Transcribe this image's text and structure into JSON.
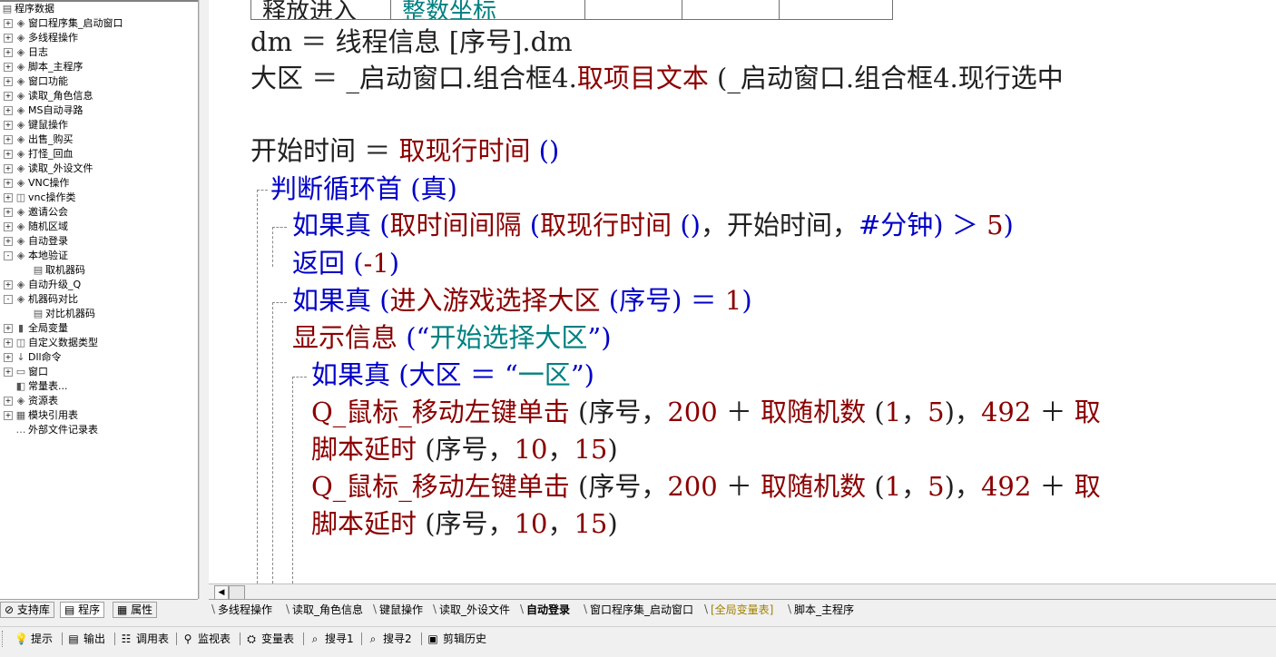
{
  "tree": {
    "root": "程序数据",
    "items": [
      {
        "label": "窗口程序集_启动窗口",
        "exp": "+",
        "icon": "module-icon"
      },
      {
        "label": "多线程操作",
        "exp": "+",
        "icon": "module-icon"
      },
      {
        "label": "日志",
        "exp": "+",
        "icon": "module-icon"
      },
      {
        "label": "脚本_主程序",
        "exp": "+",
        "icon": "module-icon"
      },
      {
        "label": "窗口功能",
        "exp": "+",
        "icon": "module-icon"
      },
      {
        "label": "读取_角色信息",
        "exp": "+",
        "icon": "module-icon"
      },
      {
        "label": "MS自动寻路",
        "exp": "+",
        "icon": "module-icon"
      },
      {
        "label": "键鼠操作",
        "exp": "+",
        "icon": "module-icon"
      },
      {
        "label": "出售_购买",
        "exp": "+",
        "icon": "module-icon"
      },
      {
        "label": "打怪_回血",
        "exp": "+",
        "icon": "module-icon"
      },
      {
        "label": "读取_外设文件",
        "exp": "+",
        "icon": "module-icon"
      },
      {
        "label": "VNC操作",
        "exp": "+",
        "icon": "module-icon"
      },
      {
        "label": "vnc操作类",
        "exp": "+",
        "icon": "class-icon"
      },
      {
        "label": "邀请公会",
        "exp": "+",
        "icon": "module-icon"
      },
      {
        "label": "随机区域",
        "exp": "+",
        "icon": "module-icon"
      },
      {
        "label": "自动登录",
        "exp": "+",
        "icon": "module-icon"
      },
      {
        "label": "本地验证",
        "exp": "-",
        "icon": "module-icon"
      },
      {
        "label": "取机器码",
        "exp": "",
        "icon": "sub-icon",
        "indent": 1
      },
      {
        "label": "自动升级_Q",
        "exp": "+",
        "icon": "module-icon"
      },
      {
        "label": "机器码对比",
        "exp": "-",
        "icon": "module-icon"
      },
      {
        "label": "对比机器码",
        "exp": "",
        "icon": "sub-icon",
        "indent": 1
      },
      {
        "label": "全局变量",
        "exp": "+",
        "icon": "globals-icon"
      },
      {
        "label": "自定义数据类型",
        "exp": "+",
        "icon": "datatype-icon"
      },
      {
        "label": "Dll命令",
        "exp": "+",
        "icon": "dll-icon"
      },
      {
        "label": "窗口",
        "exp": "+",
        "icon": "window-icon"
      },
      {
        "label": "常量表...",
        "exp": "",
        "icon": "const-icon"
      },
      {
        "label": "资源表",
        "exp": "+",
        "icon": "resource-icon"
      },
      {
        "label": "模块引用表",
        "exp": "+",
        "icon": "modref-icon"
      },
      {
        "label": "外部文件记录表",
        "exp": "",
        "icon": "file-icon"
      }
    ]
  },
  "code": {
    "table_cells": [
      "释放进入",
      "整数坐标",
      "",
      "",
      ""
    ],
    "lines": [
      [
        [
          "kw-dark",
          "dm ＝ 线程信息 [序号].dm"
        ]
      ],
      [
        [
          "kw-dark",
          "大区 ＝ _启动窗口.组合框4."
        ],
        [
          "kw-red",
          "取项目文本"
        ],
        [
          "kw-dark",
          " (_启动窗口.组合框4.现行选中"
        ]
      ],
      [],
      [
        [
          "kw-dark",
          "开始时间 ＝ "
        ],
        [
          "kw-red",
          "取现行时间"
        ],
        [
          "kw-blue",
          " ()"
        ]
      ],
      [
        [
          "kw-blue",
          "判断循环首 (真)"
        ]
      ],
      [
        [
          "kw-blue",
          "如果真 ("
        ],
        [
          "kw-red",
          "取时间间隔"
        ],
        [
          "kw-blue",
          " ("
        ],
        [
          "kw-red",
          "取现行时间"
        ],
        [
          "kw-blue",
          " ()"
        ],
        [
          "kw-dark",
          "，开始时间，"
        ],
        [
          "kw-blue",
          "#分钟) ＞ "
        ],
        [
          "kw-red",
          "5"
        ],
        [
          "kw-blue",
          ")"
        ]
      ],
      [
        [
          "kw-blue",
          "返回 ("
        ],
        [
          "kw-red",
          "-1"
        ],
        [
          "kw-blue",
          ")"
        ]
      ],
      [
        [
          "kw-blue",
          "如果真 ("
        ],
        [
          "kw-red",
          "进入游戏选择大区"
        ],
        [
          "kw-blue",
          " (序号) ＝ "
        ],
        [
          "kw-red",
          "1"
        ],
        [
          "kw-blue",
          ")"
        ]
      ],
      [
        [
          "kw-red",
          "显示信息"
        ],
        [
          "kw-blue",
          " (“"
        ],
        [
          "kw-teal",
          "开始选择大区"
        ],
        [
          "kw-blue",
          "”)"
        ]
      ],
      [
        [
          "kw-blue",
          "如果真 (大区 ＝ “"
        ],
        [
          "kw-teal",
          "一区"
        ],
        [
          "kw-blue",
          "”)"
        ]
      ],
      [
        [
          "kw-red",
          "Q_鼠标_移动左键单击"
        ],
        [
          "kw-dark",
          " (序号，"
        ],
        [
          "kw-red",
          "200"
        ],
        [
          "kw-dark",
          " ＋ "
        ],
        [
          "kw-red",
          "取随机数"
        ],
        [
          "kw-dark",
          " ("
        ],
        [
          "kw-red",
          "1"
        ],
        [
          "kw-dark",
          "，"
        ],
        [
          "kw-red",
          "5"
        ],
        [
          "kw-dark",
          ")，"
        ],
        [
          "kw-red",
          "492"
        ],
        [
          "kw-dark",
          " ＋ "
        ],
        [
          "kw-red",
          "取"
        ]
      ],
      [
        [
          "kw-red",
          "脚本延时"
        ],
        [
          "kw-dark",
          " (序号，"
        ],
        [
          "kw-red",
          "10"
        ],
        [
          "kw-dark",
          "，"
        ],
        [
          "kw-red",
          "15"
        ],
        [
          "kw-dark",
          ")"
        ]
      ],
      [
        [
          "kw-red",
          "Q_鼠标_移动左键单击"
        ],
        [
          "kw-dark",
          " (序号，"
        ],
        [
          "kw-red",
          "200"
        ],
        [
          "kw-dark",
          " ＋ "
        ],
        [
          "kw-red",
          "取随机数"
        ],
        [
          "kw-dark",
          " ("
        ],
        [
          "kw-red",
          "1"
        ],
        [
          "kw-dark",
          "，"
        ],
        [
          "kw-red",
          "5"
        ],
        [
          "kw-dark",
          ")，"
        ],
        [
          "kw-red",
          "492"
        ],
        [
          "kw-dark",
          " ＋ "
        ],
        [
          "kw-red",
          "取"
        ]
      ],
      [
        [
          "kw-red",
          "脚本延时"
        ],
        [
          "kw-dark",
          " (序号，"
        ],
        [
          "kw-red",
          "10"
        ],
        [
          "kw-dark",
          "，"
        ],
        [
          "kw-red",
          "15"
        ],
        [
          "kw-dark",
          ")"
        ]
      ]
    ]
  },
  "left_tabs": [
    {
      "label": "支持库",
      "icon": "library-icon"
    },
    {
      "label": "程序",
      "icon": "program-icon",
      "active": true
    },
    {
      "label": "属性",
      "icon": "property-icon"
    }
  ],
  "file_tabs": [
    {
      "label": "多线程操作"
    },
    {
      "label": "读取_角色信息"
    },
    {
      "label": "键鼠操作"
    },
    {
      "label": "读取_外设文件"
    },
    {
      "label": "自动登录",
      "active": true
    },
    {
      "label": "窗口程序集_启动窗口"
    },
    {
      "label": "[全局变量表]",
      "special": true
    },
    {
      "label": "脚本_主程序"
    }
  ],
  "bottom_bar": [
    {
      "label": "提示",
      "icon": "hint-icon",
      "glyph": "💡"
    },
    {
      "label": "输出",
      "icon": "output-icon",
      "glyph": "▤"
    },
    {
      "label": "调用表",
      "icon": "callstack-icon",
      "glyph": "☷"
    },
    {
      "label": "监视表",
      "icon": "watch-icon",
      "glyph": "⚲"
    },
    {
      "label": "变量表",
      "icon": "variables-icon",
      "glyph": "⛭"
    },
    {
      "label": "搜寻1",
      "icon": "search1-icon",
      "glyph": "⌕"
    },
    {
      "label": "搜寻2",
      "icon": "search2-icon",
      "glyph": "⌕"
    },
    {
      "label": "剪辑历史",
      "icon": "clipboard-icon",
      "glyph": "▣"
    }
  ]
}
